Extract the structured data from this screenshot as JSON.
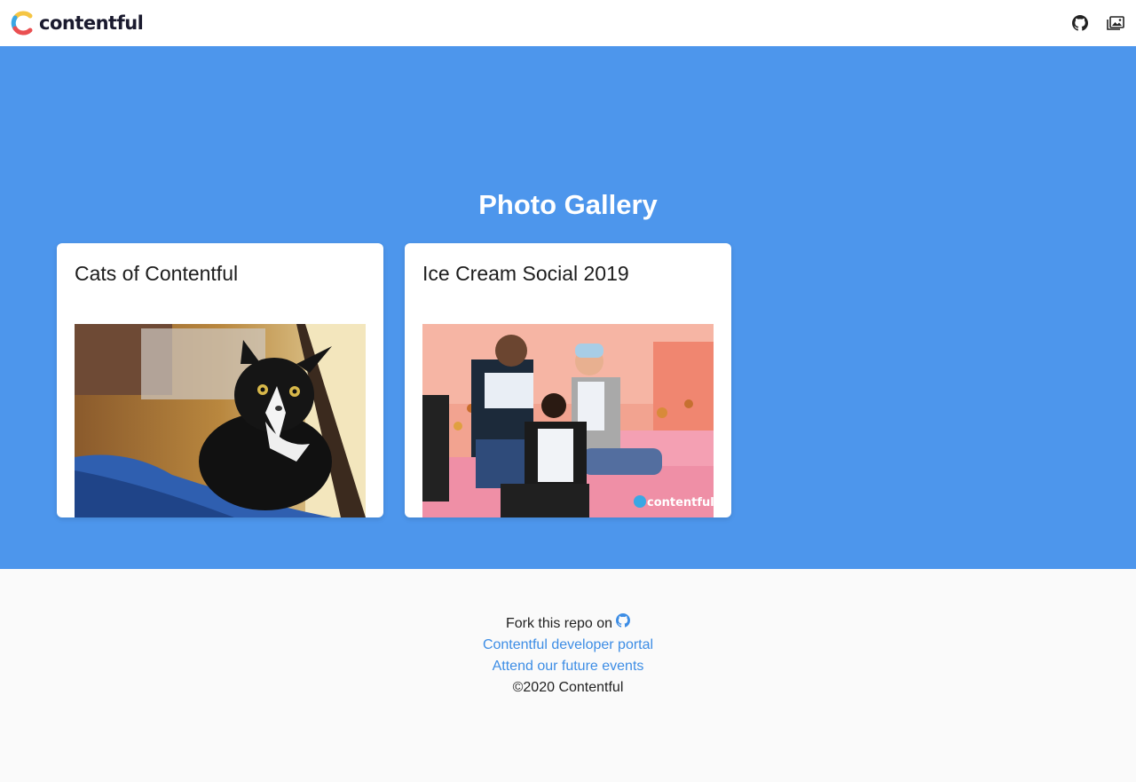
{
  "header": {
    "logo_text": "contentful",
    "icons": [
      {
        "name": "github-icon"
      },
      {
        "name": "gallery-icon"
      }
    ]
  },
  "hero": {
    "title": "Photo Gallery",
    "cards": [
      {
        "title": "Cats of Contentful",
        "image": "cat-photo"
      },
      {
        "title": "Ice Cream Social 2019",
        "image": "ice-cream-social-photo",
        "watermark": "contentful"
      }
    ]
  },
  "footer": {
    "fork_text": "Fork this repo on",
    "developer_portal": "Contentful developer portal",
    "events": "Attend our future events",
    "copyright": "©2020 Contentful"
  },
  "colors": {
    "hero_bg": "#4d96ec",
    "link": "#3d8de5",
    "footer_bg": "#fafafa"
  }
}
